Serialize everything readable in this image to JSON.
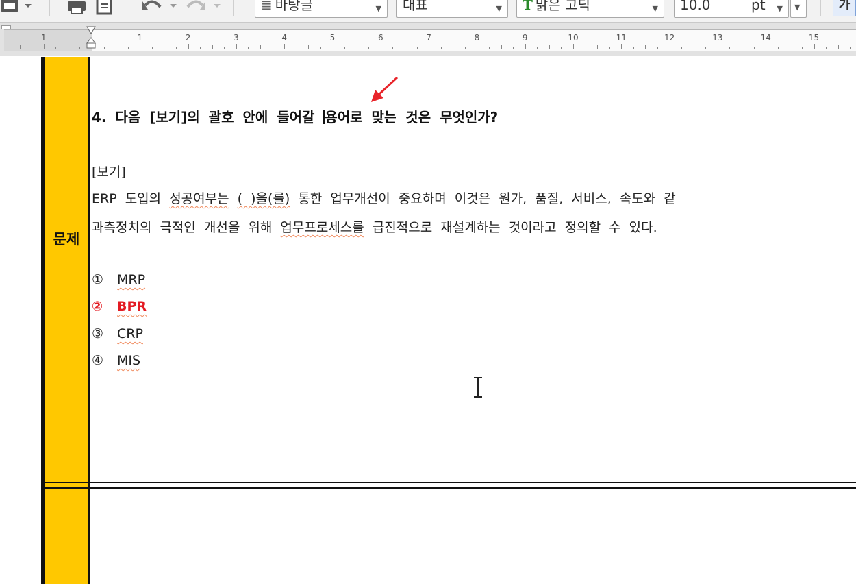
{
  "toolbar": {
    "style_value": "바탕글",
    "paragraph_value": "대표",
    "font_value": "맑은 고딕",
    "size_value": "10.0",
    "unit_value": "pt",
    "bold_label": "가"
  },
  "ruler": {
    "numbers": [
      "1",
      "1",
      "2",
      "3",
      "4",
      "5",
      "6",
      "7",
      "8",
      "9",
      "10",
      "11",
      "12",
      "13",
      "14",
      "15"
    ]
  },
  "sidebar": {
    "label": "문제"
  },
  "question": {
    "before_cursor": "4. 다음 [보기]의 괄호 안에 들어갈 ",
    "after_cursor": "용어로 맞는 것은 무엇인가?"
  },
  "bogi": {
    "title": "[보기]",
    "line1_a": "ERP 도입의 ",
    "line1_b": "성공여부는",
    "line1_c": " ",
    "line1_d": "( )을(를)",
    "line1_e": " 통한 업무개선이 중요하며 이것은 원가, 품질, 서비스, 속도와 같",
    "line2_a": "과측정치의 극적인 개선을 위해 ",
    "line2_b": "업무프로세스를",
    "line2_c": " 급진적으로 재설계하는 것이라고 정의할 수 있다."
  },
  "options": [
    {
      "num": "①",
      "text": "MRP",
      "correct": false
    },
    {
      "num": "②",
      "text": "BPR",
      "correct": true
    },
    {
      "num": "③",
      "text": "CRP",
      "correct": false
    },
    {
      "num": "④",
      "text": "MIS",
      "correct": false
    }
  ],
  "colors": {
    "accent_yellow": "#ffc800",
    "correct_red": "#e31b23",
    "arrow_red": "#e8242a"
  }
}
